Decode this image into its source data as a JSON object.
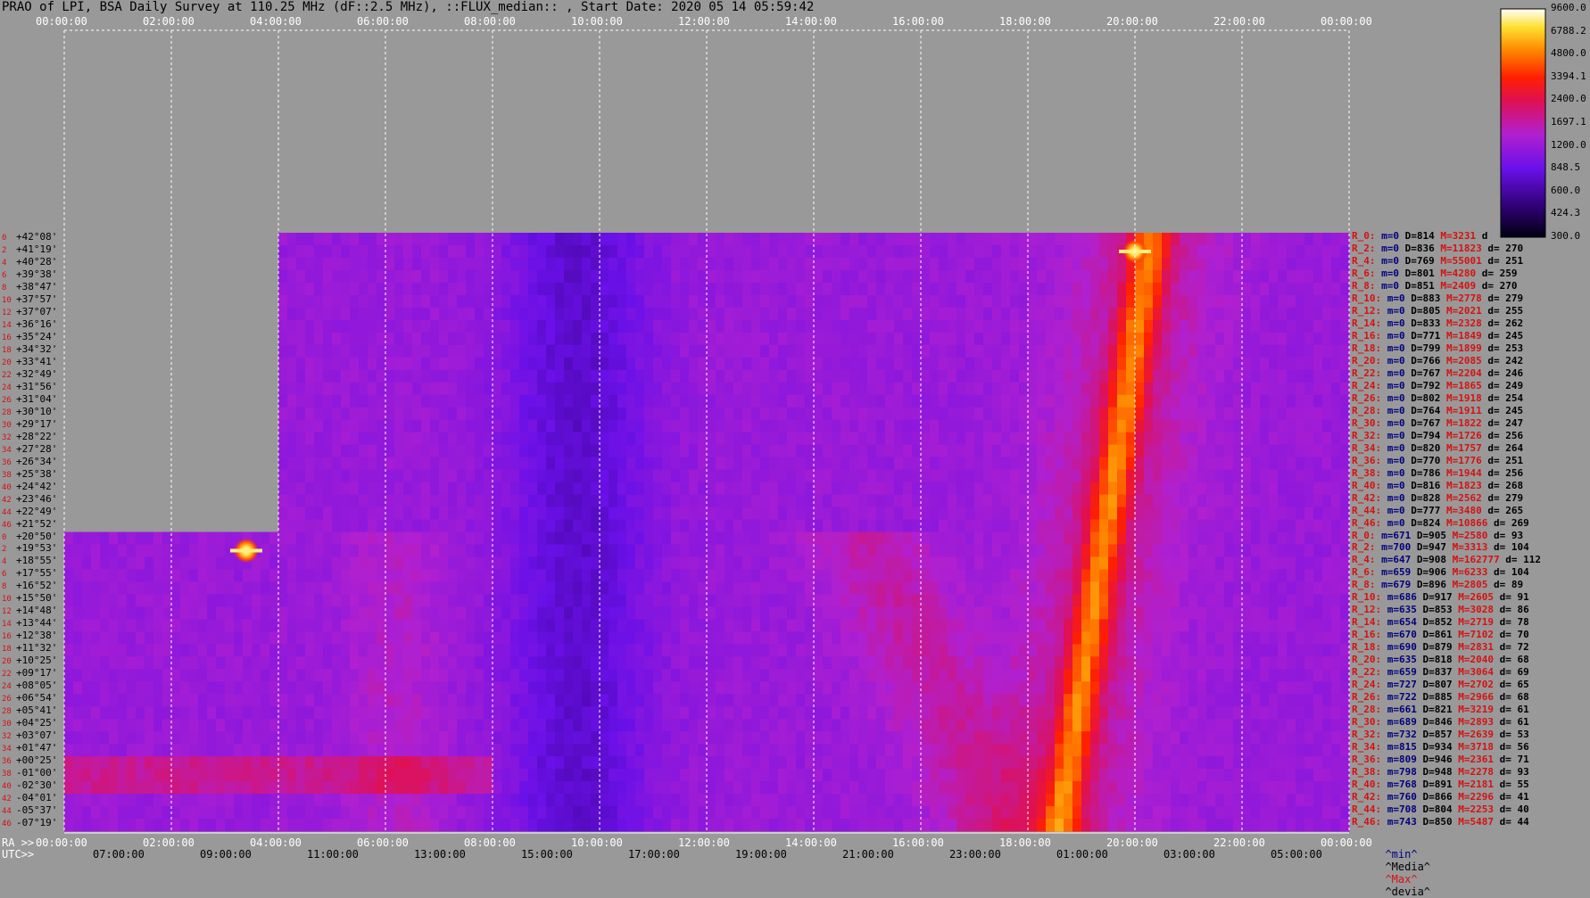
{
  "title": "PRAO of LPI, BSA Daily Survey at 110.25 MHz (dF::2.5 MHz), ::FLUX_median:: , Start Date: 2020 05 14 05:59:42",
  "colors": {
    "background": "#999999",
    "grid": "#ffffff",
    "label_red": "#d81010",
    "label_blue": "#000080"
  },
  "colorbar": {
    "ticks": [
      "9600.0",
      "6788.2",
      "4800.0",
      "3394.1",
      "2400.0",
      "1697.1",
      "1200.0",
      "848.5",
      "600.0",
      "424.3",
      "300.0"
    ],
    "colormap": "hot-purple"
  },
  "top_axis_ticks": [
    "00:00:00",
    "02:00:00",
    "04:00:00",
    "06:00:00",
    "08:00:00",
    "10:00:00",
    "12:00:00",
    "14:00:00",
    "16:00:00",
    "18:00:00",
    "20:00:00",
    "22:00:00",
    "00:00:00"
  ],
  "ra_axis": {
    "label": "RA >>",
    "ticks": [
      "00:00:00",
      "02:00:00",
      "04:00:00",
      "06:00:00",
      "08:00:00",
      "10:00:00",
      "12:00:00",
      "14:00:00",
      "16:00:00",
      "18:00:00",
      "20:00:00",
      "22:00:00",
      "00:00:00"
    ]
  },
  "utc_axis": {
    "label": "UTC>>",
    "ticks": [
      "07:00:00",
      "09:00:00",
      "11:00:00",
      "13:00:00",
      "15:00:00",
      "17:00:00",
      "19:00:00",
      "21:00:00",
      "23:00:00",
      "01:00:00",
      "03:00:00",
      "05:00:00"
    ]
  },
  "chart_data": {
    "type": "heatmap",
    "title": "PRAO of LPI, BSA Daily Survey at 110.25 MHz (dF::2.5 MHz), ::FLUX_median:: , Start Date: 2020 05 14 05:59:42",
    "x_unit": "RA hours",
    "xlim": [
      0,
      24
    ],
    "scale": "log",
    "value_range": [
      300,
      9600
    ],
    "features": [
      {
        "name": "bright source upper",
        "ra": 20.0,
        "dec_row": 1,
        "value": 9600
      },
      {
        "name": "bright source lower",
        "ra": 3.4,
        "dec_row": 25,
        "value": 9600
      },
      {
        "name": "galactic plane ridge",
        "ra_from": 20.3,
        "ra_to": 18.6,
        "value": 3400
      }
    ],
    "rows": [
      {
        "idx": "0",
        "dec": "+42°08'"
      },
      {
        "idx": "2",
        "dec": "+41°19'"
      },
      {
        "idx": "4",
        "dec": "+40°28'"
      },
      {
        "idx": "6",
        "dec": "+39°38'"
      },
      {
        "idx": "8",
        "dec": "+38°47'"
      },
      {
        "idx": "10",
        "dec": "+37°57'"
      },
      {
        "idx": "12",
        "dec": "+37°07'"
      },
      {
        "idx": "14",
        "dec": "+36°16'"
      },
      {
        "idx": "16",
        "dec": "+35°24'"
      },
      {
        "idx": "18",
        "dec": "+34°32'"
      },
      {
        "idx": "20",
        "dec": "+33°41'"
      },
      {
        "idx": "22",
        "dec": "+32°49'"
      },
      {
        "idx": "24",
        "dec": "+31°56'"
      },
      {
        "idx": "26",
        "dec": "+31°04'"
      },
      {
        "idx": "28",
        "dec": "+30°10'"
      },
      {
        "idx": "30",
        "dec": "+29°17'"
      },
      {
        "idx": "32",
        "dec": "+28°22'"
      },
      {
        "idx": "34",
        "dec": "+27°28'"
      },
      {
        "idx": "36",
        "dec": "+26°34'"
      },
      {
        "idx": "38",
        "dec": "+25°38'"
      },
      {
        "idx": "40",
        "dec": "+24°42'"
      },
      {
        "idx": "42",
        "dec": "+23°46'"
      },
      {
        "idx": "44",
        "dec": "+22°49'"
      },
      {
        "idx": "46",
        "dec": "+21°52'"
      },
      {
        "idx": "0",
        "dec": "+20°50'"
      },
      {
        "idx": "2",
        "dec": "+19°53'"
      },
      {
        "idx": "4",
        "dec": "+18°55'"
      },
      {
        "idx": "6",
        "dec": "+17°55'"
      },
      {
        "idx": "8",
        "dec": "+16°52'"
      },
      {
        "idx": "10",
        "dec": "+15°50'"
      },
      {
        "idx": "12",
        "dec": "+14°48'"
      },
      {
        "idx": "14",
        "dec": "+13°44'"
      },
      {
        "idx": "16",
        "dec": "+12°38'"
      },
      {
        "idx": "18",
        "dec": "+11°32'"
      },
      {
        "idx": "20",
        "dec": "+10°25'"
      },
      {
        "idx": "22",
        "dec": "+09°17'"
      },
      {
        "idx": "24",
        "dec": "+08°05'"
      },
      {
        "idx": "26",
        "dec": "+06°54'"
      },
      {
        "idx": "28",
        "dec": "+05°41'"
      },
      {
        "idx": "30",
        "dec": "+04°25'"
      },
      {
        "idx": "32",
        "dec": "+03°07'"
      },
      {
        "idx": "34",
        "dec": "+01°47'"
      },
      {
        "idx": "36",
        "dec": "+00°25'"
      },
      {
        "idx": "38",
        "dec": "-01°00'"
      },
      {
        "idx": "40",
        "dec": "-02°30'"
      },
      {
        "idx": "42",
        "dec": "-04°01'"
      },
      {
        "idx": "44",
        "dec": "-05°37'"
      },
      {
        "idx": "46",
        "dec": "-07°19'"
      }
    ],
    "stats": [
      {
        "r": "R_0:",
        "mn": "m=0",
        "md": "D=814",
        "mx": "M=3231",
        "dv": "d"
      },
      {
        "r": "R_2:",
        "mn": "m=0",
        "md": "D=836",
        "mx": "M=11823",
        "dv": "d= 270"
      },
      {
        "r": "R_4:",
        "mn": "m=0",
        "md": "D=769",
        "mx": "M=55001",
        "dv": "d= 251"
      },
      {
        "r": "R_6:",
        "mn": "m=0",
        "md": "D=801",
        "mx": "M=4280",
        "dv": "d= 259"
      },
      {
        "r": "R_8:",
        "mn": "m=0",
        "md": "D=851",
        "mx": "M=2409",
        "dv": "d= 270"
      },
      {
        "r": "R_10:",
        "mn": "m=0",
        "md": "D=883",
        "mx": "M=2778",
        "dv": "d= 279"
      },
      {
        "r": "R_12:",
        "mn": "m=0",
        "md": "D=805",
        "mx": "M=2021",
        "dv": "d= 255"
      },
      {
        "r": "R_14:",
        "mn": "m=0",
        "md": "D=833",
        "mx": "M=2328",
        "dv": "d= 262"
      },
      {
        "r": "R_16:",
        "mn": "m=0",
        "md": "D=771",
        "mx": "M=1849",
        "dv": "d= 245"
      },
      {
        "r": "R_18:",
        "mn": "m=0",
        "md": "D=799",
        "mx": "M=1899",
        "dv": "d= 253"
      },
      {
        "r": "R_20:",
        "mn": "m=0",
        "md": "D=766",
        "mx": "M=2085",
        "dv": "d= 242"
      },
      {
        "r": "R_22:",
        "mn": "m=0",
        "md": "D=767",
        "mx": "M=2204",
        "dv": "d= 246"
      },
      {
        "r": "R_24:",
        "mn": "m=0",
        "md": "D=792",
        "mx": "M=1865",
        "dv": "d= 249"
      },
      {
        "r": "R_26:",
        "mn": "m=0",
        "md": "D=802",
        "mx": "M=1918",
        "dv": "d= 254"
      },
      {
        "r": "R_28:",
        "mn": "m=0",
        "md": "D=764",
        "mx": "M=1911",
        "dv": "d= 245"
      },
      {
        "r": "R_30:",
        "mn": "m=0",
        "md": "D=767",
        "mx": "M=1822",
        "dv": "d= 247"
      },
      {
        "r": "R_32:",
        "mn": "m=0",
        "md": "D=794",
        "mx": "M=1726",
        "dv": "d= 256"
      },
      {
        "r": "R_34:",
        "mn": "m=0",
        "md": "D=820",
        "mx": "M=1757",
        "dv": "d= 264"
      },
      {
        "r": "R_36:",
        "mn": "m=0",
        "md": "D=770",
        "mx": "M=1776",
        "dv": "d= 251"
      },
      {
        "r": "R_38:",
        "mn": "m=0",
        "md": "D=786",
        "mx": "M=1944",
        "dv": "d= 256"
      },
      {
        "r": "R_40:",
        "mn": "m=0",
        "md": "D=816",
        "mx": "M=1823",
        "dv": "d= 268"
      },
      {
        "r": "R_42:",
        "mn": "m=0",
        "md": "D=828",
        "mx": "M=2562",
        "dv": "d= 279"
      },
      {
        "r": "R_44:",
        "mn": "m=0",
        "md": "D=777",
        "mx": "M=3480",
        "dv": "d= 265"
      },
      {
        "r": "R_46:",
        "mn": "m=0",
        "md": "D=824",
        "mx": "M=10866",
        "dv": "d= 269"
      },
      {
        "r": "R_0:",
        "mn": "m=671",
        "md": "D=905",
        "mx": "M=2580",
        "dv": "d= 93"
      },
      {
        "r": "R_2:",
        "mn": "m=700",
        "md": "D=947",
        "mx": "M=3313",
        "dv": "d= 104"
      },
      {
        "r": "R_4:",
        "mn": "m=647",
        "md": "D=908",
        "mx": "M=162777",
        "dv": "d= 112"
      },
      {
        "r": "R_6:",
        "mn": "m=659",
        "md": "D=906",
        "mx": "M=6233",
        "dv": "d= 104"
      },
      {
        "r": "R_8:",
        "mn": "m=679",
        "md": "D=896",
        "mx": "M=2805",
        "dv": "d= 89"
      },
      {
        "r": "R_10:",
        "mn": "m=686",
        "md": "D=917",
        "mx": "M=2605",
        "dv": "d= 91"
      },
      {
        "r": "R_12:",
        "mn": "m=635",
        "md": "D=853",
        "mx": "M=3028",
        "dv": "d= 86"
      },
      {
        "r": "R_14:",
        "mn": "m=654",
        "md": "D=852",
        "mx": "M=2719",
        "dv": "d= 78"
      },
      {
        "r": "R_16:",
        "mn": "m=670",
        "md": "D=861",
        "mx": "M=7102",
        "dv": "d= 70"
      },
      {
        "r": "R_18:",
        "mn": "m=690",
        "md": "D=879",
        "mx": "M=2831",
        "dv": "d= 72"
      },
      {
        "r": "R_20:",
        "mn": "m=635",
        "md": "D=818",
        "mx": "M=2040",
        "dv": "d= 68"
      },
      {
        "r": "R_22:",
        "mn": "m=659",
        "md": "D=837",
        "mx": "M=3064",
        "dv": "d= 69"
      },
      {
        "r": "R_24:",
        "mn": "m=727",
        "md": "D=807",
        "mx": "M=2702",
        "dv": "d= 65"
      },
      {
        "r": "R_26:",
        "mn": "m=722",
        "md": "D=885",
        "mx": "M=2966",
        "dv": "d= 68"
      },
      {
        "r": "R_28:",
        "mn": "m=661",
        "md": "D=821",
        "mx": "M=3219",
        "dv": "d= 61"
      },
      {
        "r": "R_30:",
        "mn": "m=689",
        "md": "D=846",
        "mx": "M=2893",
        "dv": "d= 61"
      },
      {
        "r": "R_32:",
        "mn": "m=732",
        "md": "D=857",
        "mx": "M=2639",
        "dv": "d= 53"
      },
      {
        "r": "R_34:",
        "mn": "m=815",
        "md": "D=934",
        "mx": "M=3718",
        "dv": "d= 56"
      },
      {
        "r": "R_36:",
        "mn": "m=809",
        "md": "D=946",
        "mx": "M=2361",
        "dv": "d= 71"
      },
      {
        "r": "R_38:",
        "mn": "m=798",
        "md": "D=948",
        "mx": "M=2278",
        "dv": "d= 93"
      },
      {
        "r": "R_40:",
        "mn": "m=768",
        "md": "D=891",
        "mx": "M=2181",
        "dv": "d= 55"
      },
      {
        "r": "R_42:",
        "mn": "m=760",
        "md": "D=866",
        "mx": "M=2296",
        "dv": "d= 41"
      },
      {
        "r": "R_44:",
        "mn": "m=708",
        "md": "D=804",
        "mx": "M=2253",
        "dv": "d= 40"
      },
      {
        "r": "R_46:",
        "mn": "m=743",
        "md": "D=850",
        "mx": "M=5487",
        "dv": "d= 44"
      }
    ]
  },
  "legend": {
    "min": "^min^",
    "median": "^Media^",
    "max": "^Max^",
    "dev": "^devia^"
  }
}
